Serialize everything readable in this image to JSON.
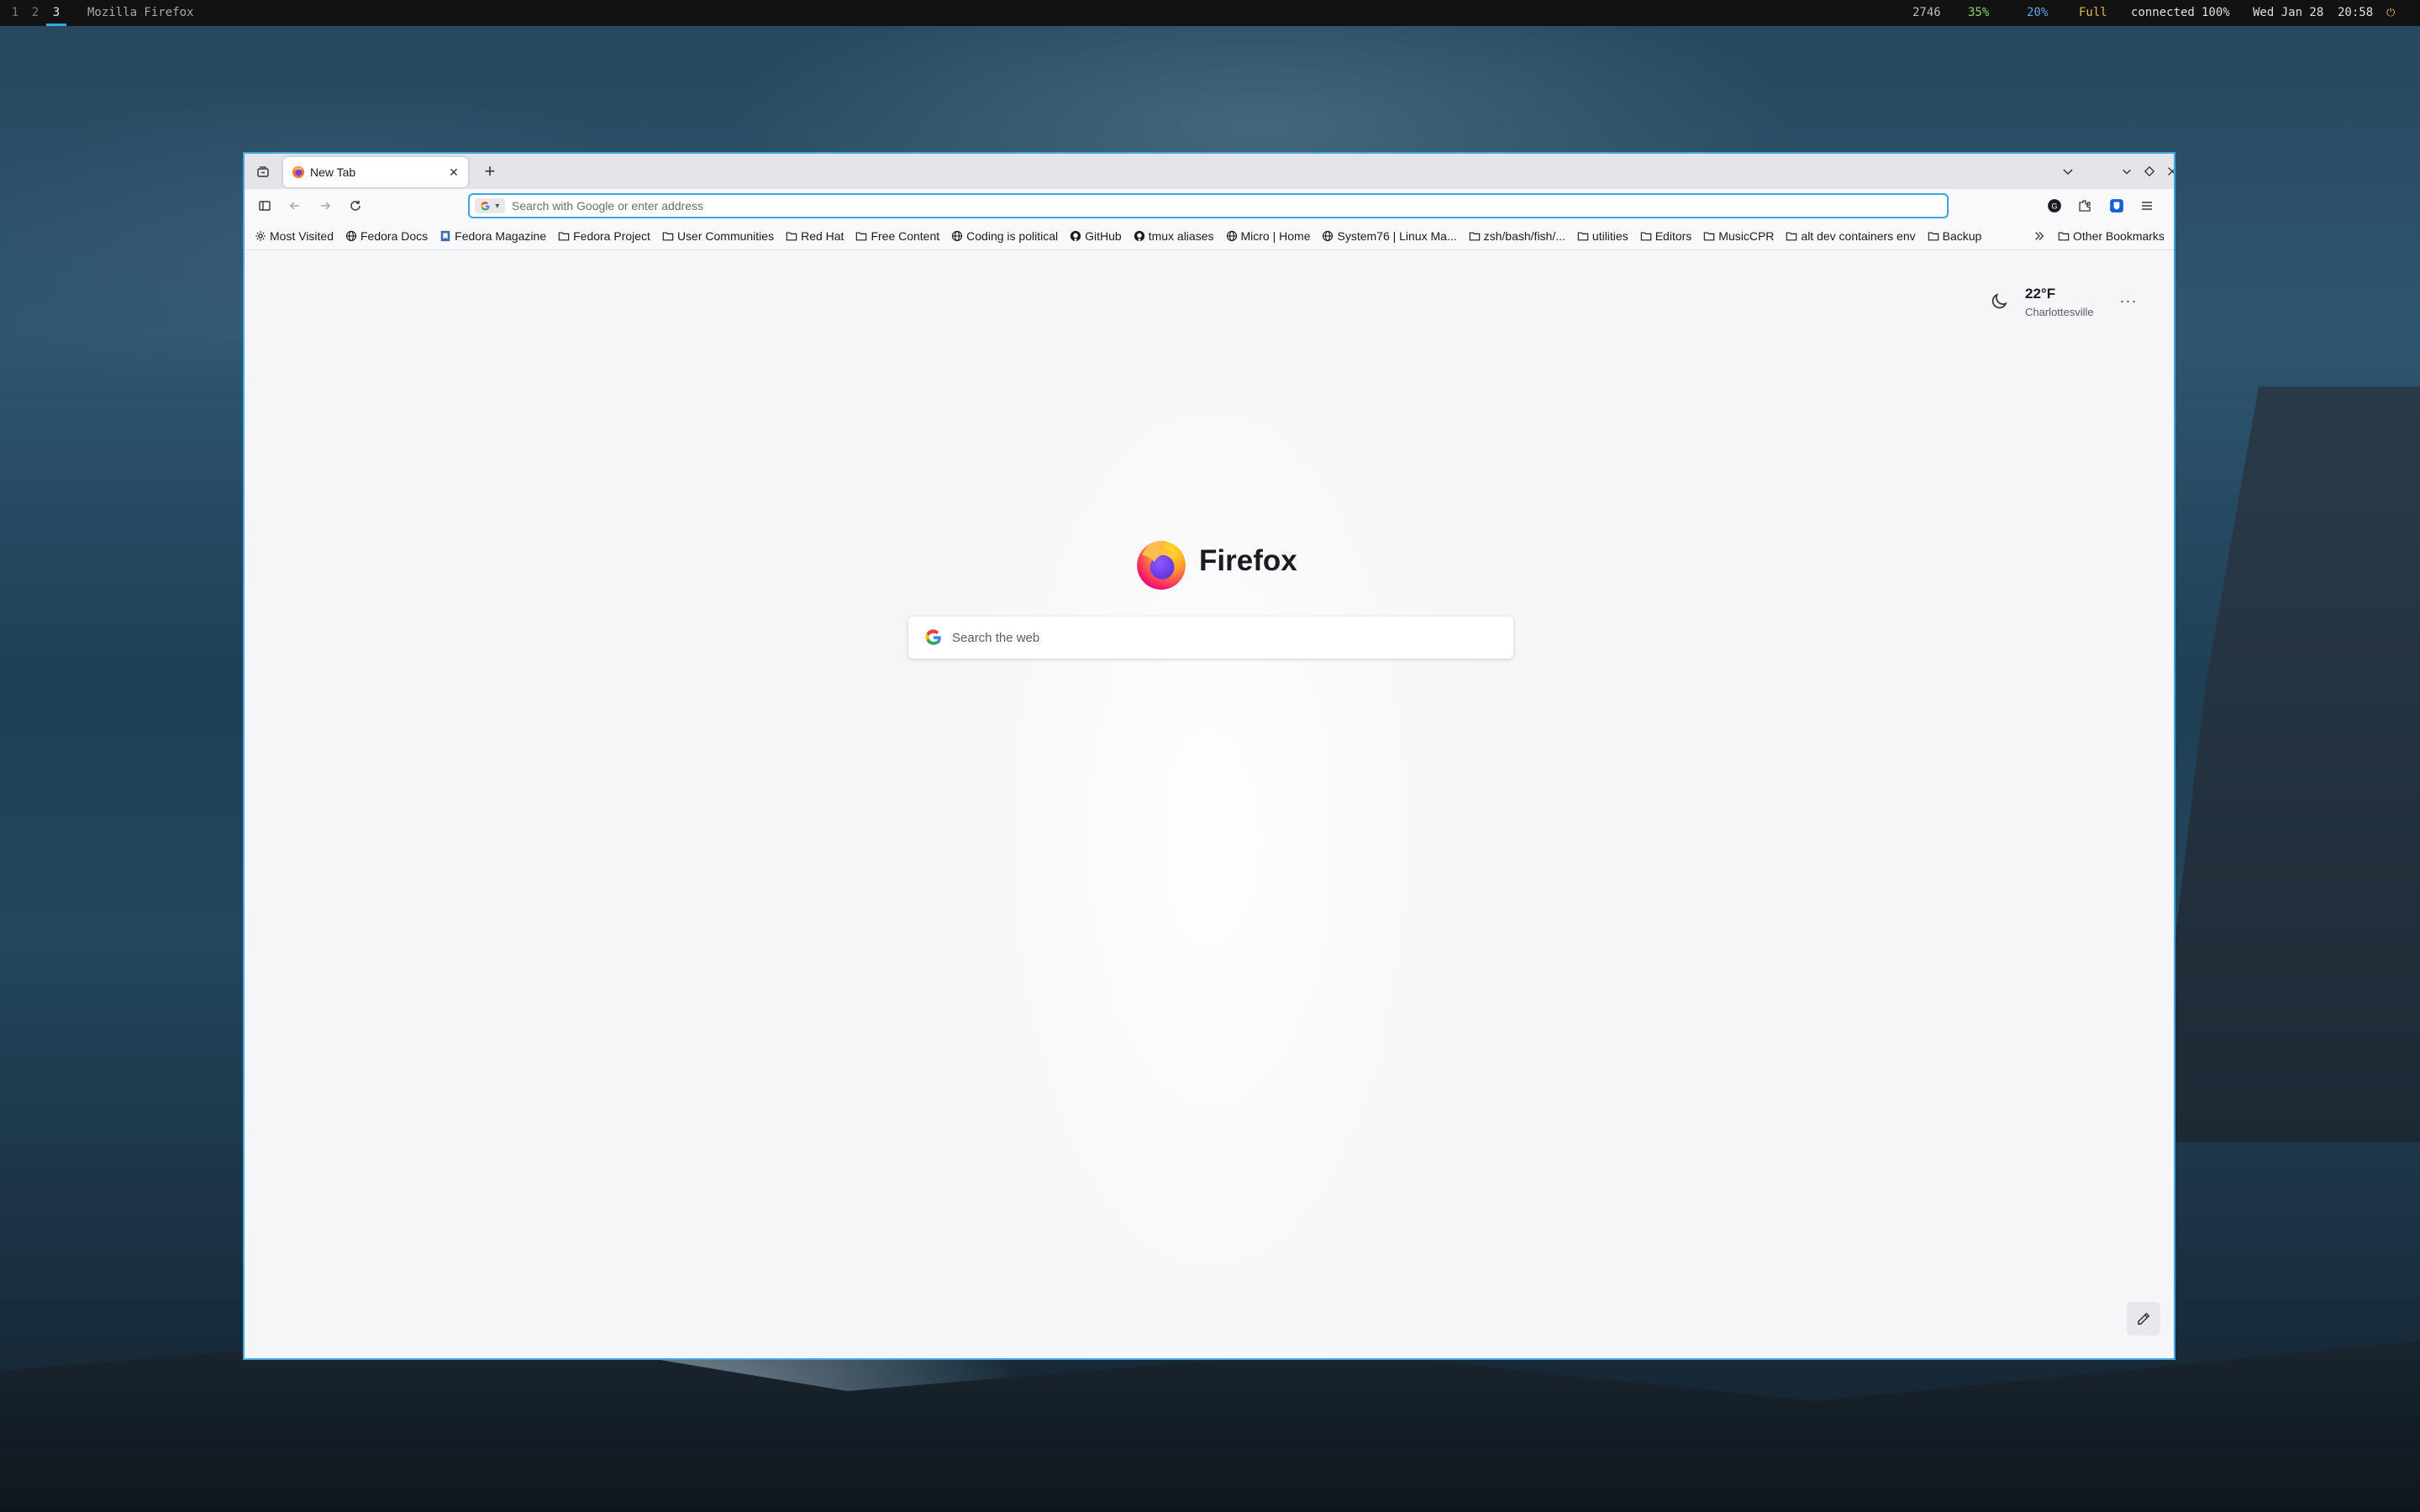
{
  "topbar": {
    "workspaces": [
      {
        "label": "1",
        "active": false
      },
      {
        "label": "2",
        "active": false
      },
      {
        "label": "3",
        "active": true
      }
    ],
    "window_title": "Mozilla Firefox",
    "stats": {
      "updates": "2746",
      "cpu": "35%",
      "memory": "20%",
      "battery_state": "Full",
      "network": "connected",
      "volume": "100%",
      "date": "Wed Jan 28",
      "time": "20:58"
    },
    "colors": {
      "cpu": "#8bd46a",
      "memory": "#5aa7e6",
      "battery": "#e0b84a"
    },
    "power_icon": "power-icon"
  },
  "browser": {
    "tabs": [
      {
        "title": "New Tab",
        "favicon": "firefox-icon",
        "active": true
      }
    ],
    "urlbar": {
      "placeholder": "Search with Google or enter address",
      "value": "",
      "engine_icon": "google-icon"
    },
    "bookmarks": [
      {
        "label": "Most Visited",
        "icon": "gear-icon"
      },
      {
        "label": "Fedora Docs",
        "icon": "globe-icon"
      },
      {
        "label": "Fedora Magazine",
        "icon": "bookmark-icon"
      },
      {
        "label": "Fedora Project",
        "icon": "folder-icon"
      },
      {
        "label": "User Communities",
        "icon": "folder-icon"
      },
      {
        "label": "Red Hat",
        "icon": "folder-icon"
      },
      {
        "label": "Free Content",
        "icon": "folder-icon"
      },
      {
        "label": "Coding is political",
        "icon": "globe-icon"
      },
      {
        "label": "GitHub",
        "icon": "github-icon"
      },
      {
        "label": "tmux aliases",
        "icon": "github-icon"
      },
      {
        "label": "Micro | Home",
        "icon": "globe-icon"
      },
      {
        "label": "System76 | Linux Ma...",
        "icon": "globe-icon"
      },
      {
        "label": "zsh/bash/fish/...",
        "icon": "folder-icon"
      },
      {
        "label": "utilities",
        "icon": "folder-icon"
      },
      {
        "label": "Editors",
        "icon": "folder-icon"
      },
      {
        "label": "MusicCPR",
        "icon": "folder-icon"
      },
      {
        "label": "alt dev containers env",
        "icon": "folder-icon"
      },
      {
        "label": "Backup",
        "icon": "folder-icon"
      }
    ],
    "other_bookmarks": "Other Bookmarks",
    "accent": "#3aa6e6"
  },
  "newtab": {
    "weather": {
      "temp": "22°F",
      "city": "Charlottesville",
      "icon": "moon-icon"
    },
    "logo_text": "Firefox",
    "search_placeholder": "Search the web"
  }
}
